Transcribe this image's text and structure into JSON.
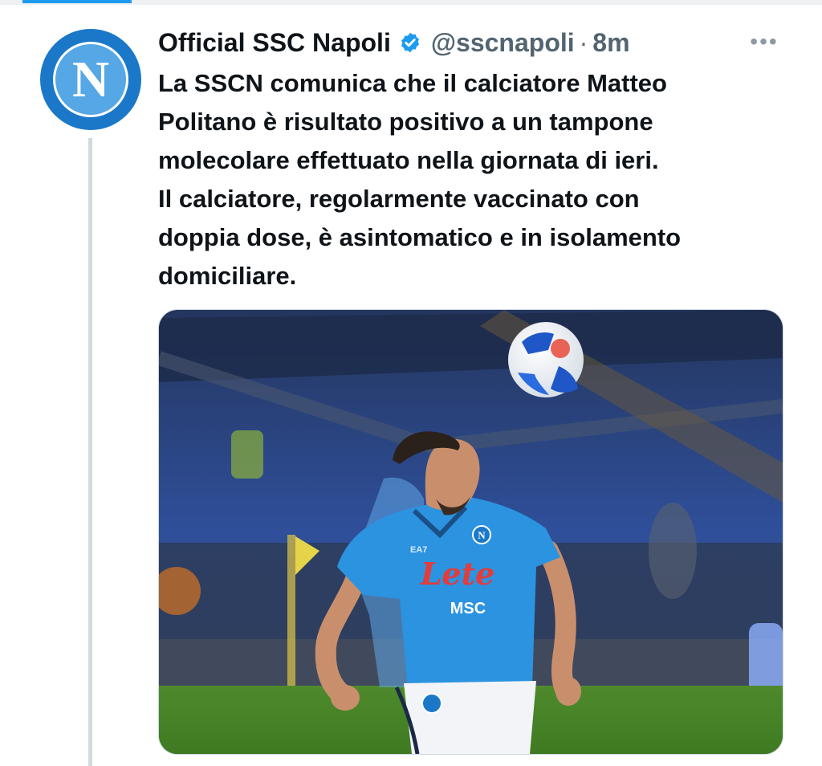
{
  "author": {
    "name": "Official SSC Napoli",
    "handle": "@sscnapoli",
    "time": "8m",
    "avatar_letter": "N",
    "verified": true
  },
  "tweet": {
    "lines": [
      "La SSCN comunica che il calciatore Matteo",
      "Politano è risultato positivo a un tampone",
      "molecolare effettuato nella giornata di ieri.",
      "Il calciatore, regolarmente vaccinato con",
      "doppia dose, è asintomatico e in isolamento",
      "domiciliare."
    ]
  },
  "media": {
    "shirt_sponsor": "Lete",
    "shirt_secondary": "MSC",
    "shirt_brand": "EA7",
    "crest_letter": "N"
  },
  "icons": {
    "more": "more-horizontal-icon",
    "verified": "verified-badge-icon"
  },
  "colors": {
    "accent": "#1d9bf0",
    "text": "#0f1419",
    "muted": "#536471",
    "napoli_blue": "#1b78c8"
  }
}
